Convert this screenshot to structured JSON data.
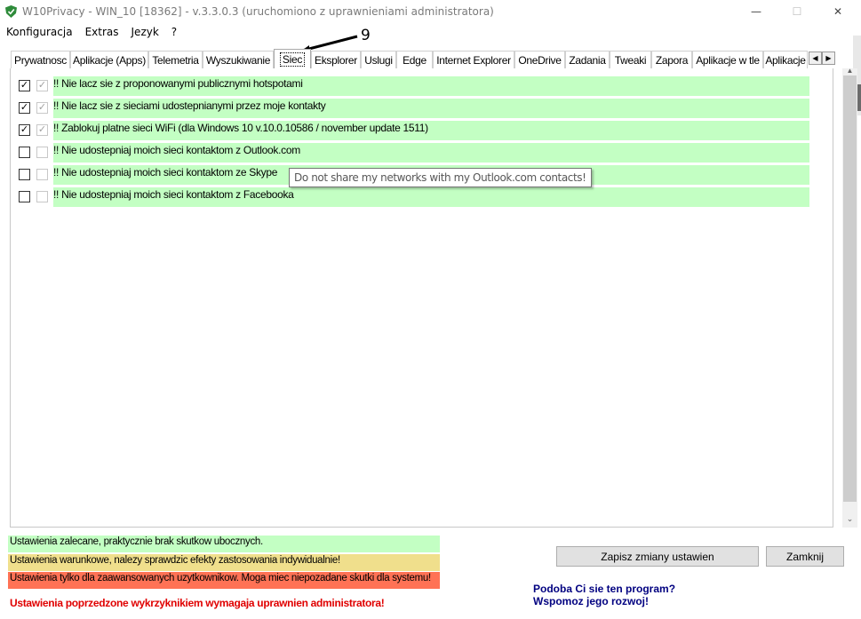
{
  "window": {
    "title": "W10Privacy - WIN_10 [18362]  - v.3.3.0.3 (uruchomiono z uprawnieniami administratora)",
    "minimize": "—",
    "maximize": "☐",
    "close": "✕"
  },
  "menu": [
    "Konfiguracja",
    "Extras",
    "Jezyk",
    "?"
  ],
  "tabs": [
    {
      "label": "Prywatnosc"
    },
    {
      "label": "Aplikacje (Apps)"
    },
    {
      "label": "Telemetria"
    },
    {
      "label": "Wyszukiwanie"
    },
    {
      "label": "Siec",
      "active": true
    },
    {
      "label": "Eksplorer"
    },
    {
      "label": "Uslugi"
    },
    {
      "label": "Edge"
    },
    {
      "label": "Internet Explorer"
    },
    {
      "label": "OneDrive"
    },
    {
      "label": "Zadania"
    },
    {
      "label": "Tweaki"
    },
    {
      "label": "Zapora"
    },
    {
      "label": "Aplikacje w tle"
    },
    {
      "label": "Aplikacje"
    }
  ],
  "tab_scroll": {
    "left": "◀",
    "right": "▶"
  },
  "annotation": {
    "number": "9"
  },
  "settings": [
    {
      "label": "!! Nie lacz sie z proponowanymi publicznymi hotspotami",
      "checked": true,
      "recommended": true
    },
    {
      "label": "!! Nie lacz sie z sieciami udostepnianymi przez moje kontakty",
      "checked": true,
      "recommended": true
    },
    {
      "label": "!! Zablokuj platne sieci WiFi (dla Windows 10 v.10.0.10586 / november update 1511)",
      "checked": true,
      "recommended": true
    },
    {
      "label": "!! Nie udostepniaj moich sieci kontaktom z Outlook.com",
      "checked": false,
      "recommended": false
    },
    {
      "label": "!! Nie udostepniaj moich sieci kontaktom ze Skype",
      "checked": false,
      "recommended": false
    },
    {
      "label": "!! Nie udostepniaj moich sieci kontaktom z Facebooka",
      "checked": false,
      "recommended": false
    }
  ],
  "tooltip": "Do not share my networks with my Outlook.com contacts!",
  "legend": {
    "green": "Ustawienia zalecane, praktycznie brak skutkow ubocznych.",
    "yellow": "Ustawienia warunkowe, nalezy sprawdzic efekty zastosowania indywidualnie!",
    "red": "Ustawienia tylko dla zaawansowanych uzytkownikow. Moga miec niepozadane skutki dla systemu!",
    "admin_note": "Ustawienia poprzedzone wykrzyknikiem wymagaja uprawnien administratora!"
  },
  "buttons": {
    "save": "Zapisz zmiany ustawien",
    "close": "Zamknij"
  },
  "support": {
    "line1": "Podoba Ci sie ten program?",
    "line2": "Wspomoz jego rozwoj!"
  },
  "colors": {
    "recommended": "#c3ffc3",
    "conditional": "#f0df8c",
    "advanced": "#ff7255",
    "admin_note": "#e00000",
    "support_link": "#000080"
  },
  "icons": {
    "app": "shield-icon",
    "check": "checkmark-icon"
  }
}
